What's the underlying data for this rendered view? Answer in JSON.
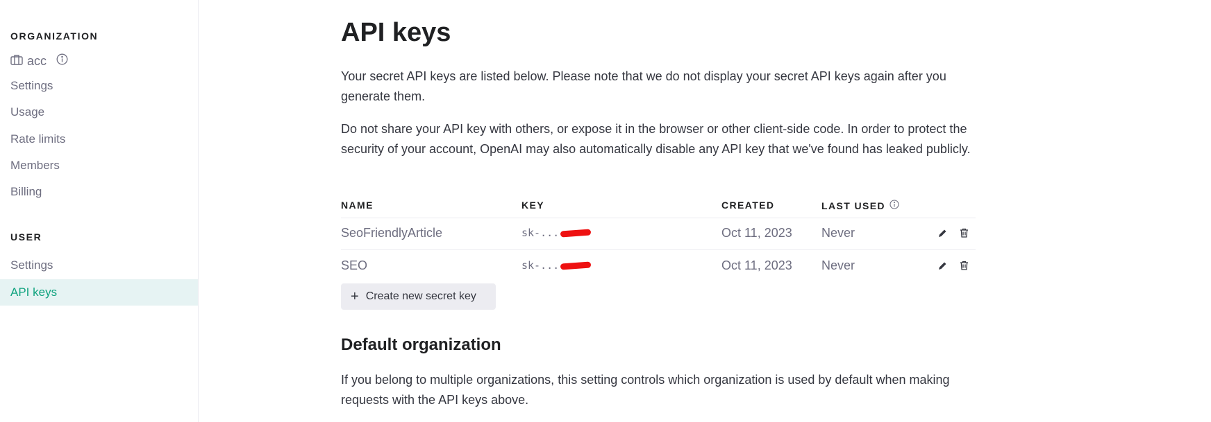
{
  "sidebar": {
    "org_heading": "ORGANIZATION",
    "org_name": "acc",
    "org_items": [
      {
        "label": "Settings"
      },
      {
        "label": "Usage"
      },
      {
        "label": "Rate limits"
      },
      {
        "label": "Members"
      },
      {
        "label": "Billing"
      }
    ],
    "user_heading": "USER",
    "user_items": [
      {
        "label": "Settings"
      },
      {
        "label": "API keys",
        "active": true
      }
    ]
  },
  "main": {
    "title": "API keys",
    "intro": "Your secret API keys are listed below. Please note that we do not display your secret API keys again after you generate them.",
    "warning": "Do not share your API key with others, or expose it in the browser or other client-side code. In order to protect the security of your account, OpenAI may also automatically disable any API key that we've found has leaked publicly.",
    "table": {
      "headers": {
        "name": "NAME",
        "key": "KEY",
        "created": "CREATED",
        "last_used": "LAST USED"
      },
      "rows": [
        {
          "name": "SeoFriendlyArticle",
          "key": "sk-...",
          "created": "Oct 11, 2023",
          "last_used": "Never"
        },
        {
          "name": "SEO",
          "key": "sk-...",
          "created": "Oct 11, 2023",
          "last_used": "Never"
        }
      ]
    },
    "create_button": "Create new secret key",
    "default_org_heading": "Default organization",
    "default_org_text": "If you belong to multiple organizations, this setting controls which organization is used by default when making requests with the API keys above."
  },
  "colors": {
    "accent": "#10a37f",
    "active_bg": "#e6f3f3",
    "redaction": "#ee1111"
  },
  "icons": [
    "briefcase-icon",
    "info-icon",
    "edit-icon",
    "trash-icon",
    "plus-icon"
  ]
}
